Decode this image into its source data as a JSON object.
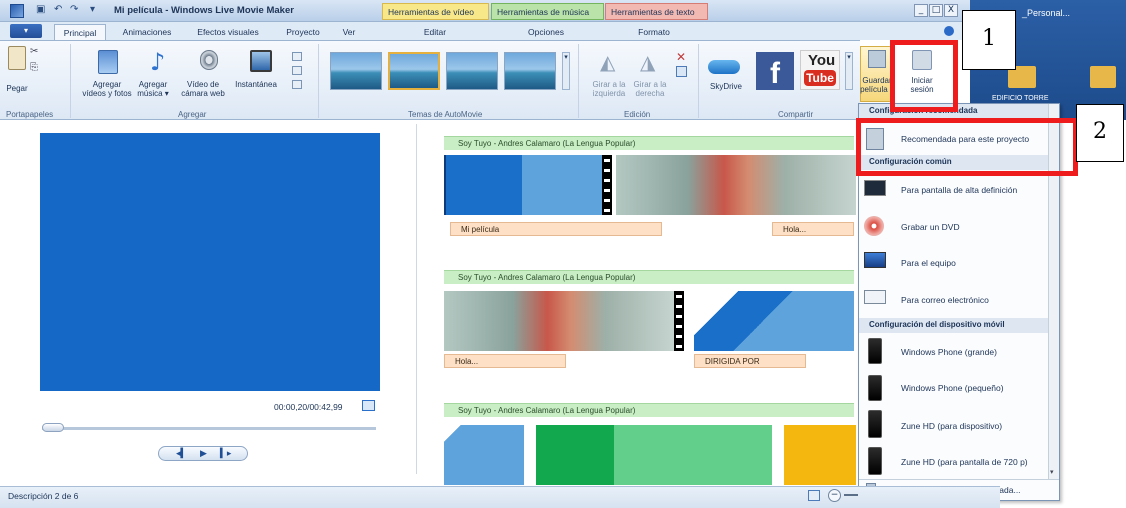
{
  "window": {
    "title": "Mi película - Windows Live Movie Maker",
    "context_tabs": {
      "video": "Herramientas de vídeo",
      "music": "Herramientas de música",
      "text": "Herramientas de texto"
    },
    "controls": {
      "minimize": "_",
      "maximize": "□",
      "close": "X"
    }
  },
  "desktop": {
    "label_top": "_Personal...",
    "folder_label": "EDIFICIO TORRE"
  },
  "tabs": {
    "menu": "▾",
    "items": [
      "Principal",
      "Animaciones",
      "Efectos visuales",
      "Proyecto",
      "Ver",
      "Editar",
      "Opciones",
      "Formato"
    ],
    "active": "Principal"
  },
  "ribbon": {
    "portapapeles": {
      "pegar": "Pegar",
      "group": "Portapapeles"
    },
    "agregar": {
      "videos": "Agregar vídeos y fotos",
      "musica": "Agregar música ▾",
      "camara": "Vídeo de cámara web",
      "instantanea": "Instantánea",
      "group": "Agregar"
    },
    "temas": {
      "group": "Temas de AutoMovie"
    },
    "edicion": {
      "girar_izq": "Girar a la izquierda",
      "girar_der": "Girar a la derecha",
      "group": "Edición"
    },
    "compartir": {
      "skydrive": "SkyDrive",
      "youtube_line1": "You",
      "youtube_line2": "Tube",
      "facebook": "f",
      "guardar": "Guardar película ▾",
      "iniciar": "Iniciar sesión",
      "group": "Compartir"
    }
  },
  "preview": {
    "time": "00:00,20/00:42,99"
  },
  "storyboard": {
    "row1": {
      "music": "Soy Tuyo - Andres Calamaro (La Lengua Popular)",
      "caption1": "Mi película",
      "caption2": "Hola..."
    },
    "row2": {
      "music": "Soy Tuyo - Andres Calamaro (La Lengua Popular)",
      "caption1": "Hola...",
      "caption2": "DIRIGIDA POR"
    },
    "row3": {
      "music": "Soy Tuyo - Andres Calamaro (La Lengua Popular)"
    }
  },
  "dropdown": {
    "section_recommended": "Configuración recomendada",
    "recommended": "Recomendada para este proyecto",
    "section_common": "Configuración común",
    "hd": "Para pantalla de alta definición",
    "dvd": "Grabar un DVD",
    "pc": "Para el equipo",
    "email": "Para correo electrónico",
    "section_mobile": "Configuración del dispositivo móvil",
    "wp_large": "Windows Phone (grande)",
    "wp_small": "Windows Phone (pequeño)",
    "zune_device": "Zune HD (para dispositivo)",
    "zune_720": "Zune HD (para pantalla de 720 p)",
    "custom": "Crear configuración personalizada..."
  },
  "status": {
    "text": "Descripción 2 de 6"
  },
  "annotations": {
    "one": "1",
    "two": "2"
  },
  "colors": {
    "annotation_red": "#ee1c1c",
    "preview_blue": "#1668c7"
  }
}
